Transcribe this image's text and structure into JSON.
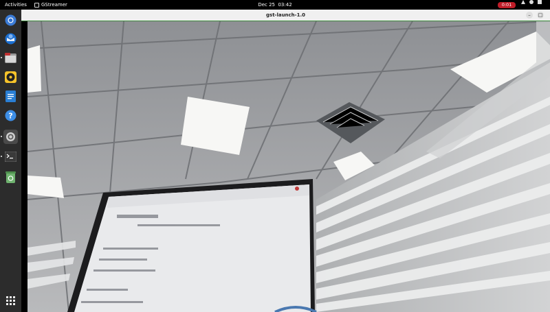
{
  "topbar": {
    "activities": "Activities",
    "app_name": "GStreamer",
    "clock_date": "Dec 25",
    "clock_time": "03:42",
    "recording": "0:01"
  },
  "window": {
    "title": "gst-launch-1.0"
  },
  "dock": {
    "items": [
      {
        "name": "chromium",
        "icon": "chromium-icon"
      },
      {
        "name": "thunderbird",
        "icon": "thunderbird-icon"
      },
      {
        "name": "files",
        "icon": "files-icon"
      },
      {
        "name": "rhythmbox",
        "icon": "rhythmbox-icon"
      },
      {
        "name": "libreoffice-writer",
        "icon": "writer-icon"
      },
      {
        "name": "help",
        "icon": "help-icon"
      },
      {
        "name": "settings",
        "icon": "gear-icon"
      },
      {
        "name": "terminal",
        "icon": "terminal-icon"
      },
      {
        "name": "trash",
        "icon": "trash-icon"
      },
      {
        "name": "show-apps",
        "icon": "app-grid-icon"
      }
    ]
  },
  "colors": {
    "topbar_bg": "#000000",
    "dock_bg": "#2c2c2c",
    "record_red": "#c01c28",
    "titlebar_bg": "#f0f0f0"
  }
}
